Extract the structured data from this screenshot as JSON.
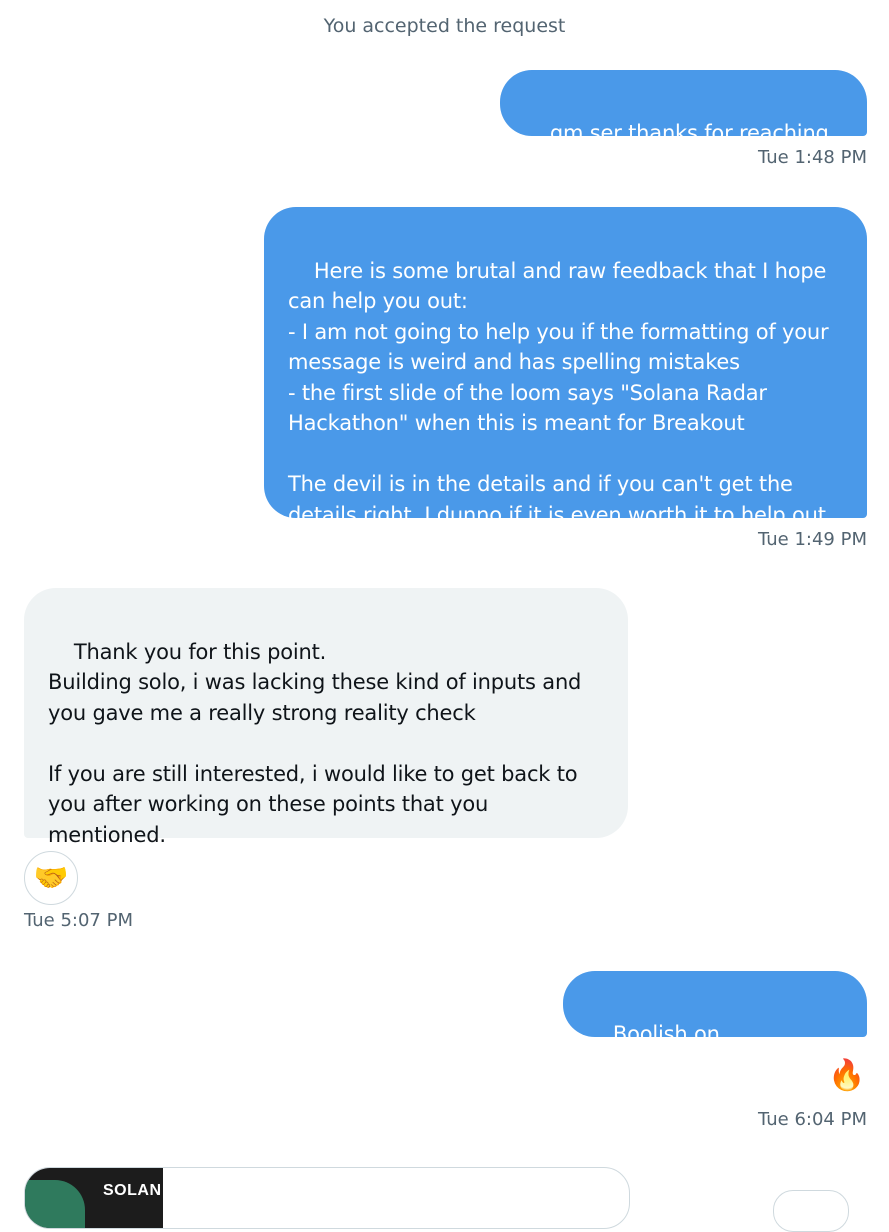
{
  "system_note": "You accepted the request",
  "messages": [
    {
      "text": "gm ser thanks for reaching out",
      "time": "Tue 1:48 PM"
    },
    {
      "text": "Here is some brutal and raw feedback that I hope\ncan help you out:\n- I am not going to help you if the formatting of your\nmessage is weird and has spelling mistakes\n- the first slide of the loom says \"Solana Radar\nHackathon\" when this is meant for Breakout\n\nThe devil is in the details and if you can't get the\ndetails right, I dunno if it is even worth it to help out",
      "time": "Tue 1:49 PM"
    },
    {
      "text": "Thank you for this point.\nBuilding solo, i was lacking these kind of inputs and\nyou gave me a really strong reality check\n\nIf you are still interested, i would like to get back to\nyou after working on these points that you\nmentioned.",
      "reaction": "🤝",
      "time": "Tue 5:07 PM"
    },
    {
      "text": "Boolish on improvement",
      "reaction": "🔥",
      "time": "Tue 6:04 PM"
    }
  ],
  "link_preview": {
    "thumb_text": "SOLAN"
  },
  "colors": {
    "sent_bubble": "#4a99e9",
    "received_bubble": "#eff3f4",
    "timestamp": "#536471"
  }
}
